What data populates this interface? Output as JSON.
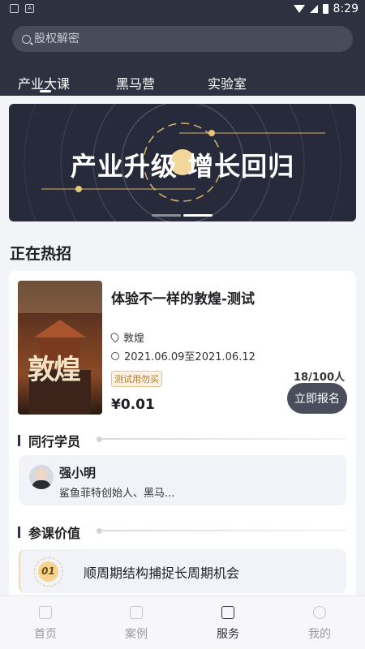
{
  "status_bar": {
    "time": "8:29"
  },
  "search": {
    "placeholder": "股权解密"
  },
  "tabs": [
    {
      "label": "产业大课",
      "active": true
    },
    {
      "label": "黑马营",
      "active": false
    },
    {
      "label": "实验室",
      "active": false
    }
  ],
  "banner": {
    "title": "产业升级 增长回归",
    "active_dot": 2,
    "dot_count": 3
  },
  "hot": {
    "section_title": "正在热招",
    "course": {
      "title": "体验不一样的敦煌-测试",
      "location": "敦煌",
      "date_range": "2021.06.09至2021.06.12",
      "tag": "测试用勿买",
      "price": "¥0.01",
      "enrolled": "18/100人",
      "enroll_button": "立即报名",
      "poster_text": "敦煌"
    },
    "peers_title": "同行学员",
    "peer": {
      "name": "强小明",
      "description": "鲨鱼菲特创始人、黑马..."
    },
    "value_title": "参课价值",
    "value_item": {
      "number": "01",
      "text": "顺周期结构捕捉长周期机会"
    }
  },
  "bottom_nav": [
    {
      "label": "首页",
      "icon": "home-icon",
      "active": false
    },
    {
      "label": "案例",
      "icon": "case-icon",
      "active": false
    },
    {
      "label": "服务",
      "icon": "service-icon",
      "active": true
    },
    {
      "label": "我的",
      "icon": "profile-icon",
      "active": false
    }
  ],
  "colors": {
    "header_bg": "#2e3140",
    "accent_gold": "#e6c27e",
    "enroll_button": "#4a4d5c"
  }
}
